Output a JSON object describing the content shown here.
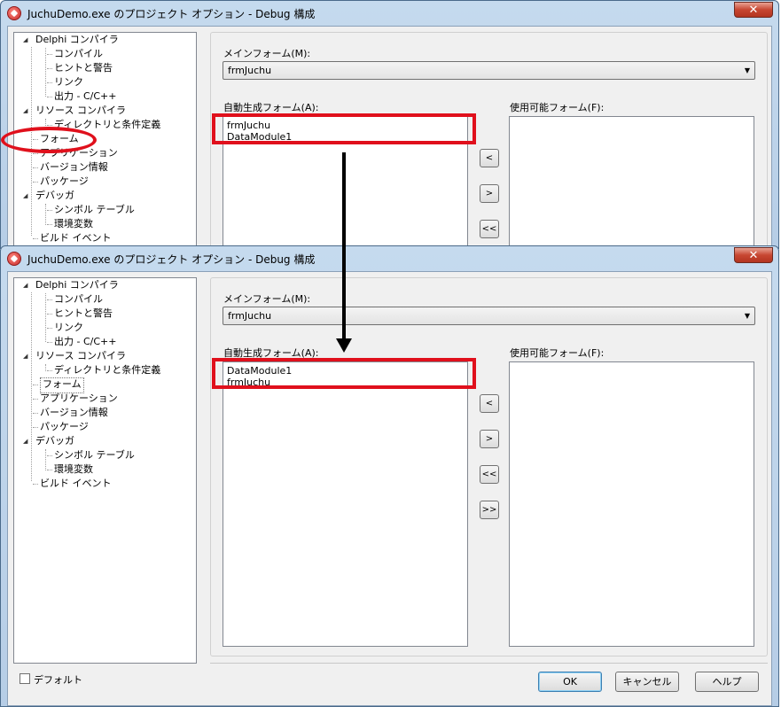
{
  "top_window": {
    "title": "JuchuDemo.exe のプロジェクト オプション - Debug 構成",
    "close_label": "✕",
    "tree": [
      {
        "label": "Delphi コンパイラ"
      },
      {
        "label": "コンパイル"
      },
      {
        "label": "ヒントと警告"
      },
      {
        "label": "リンク"
      },
      {
        "label": "出力 - C/C++"
      },
      {
        "label": "リソース コンパイラ"
      },
      {
        "label": "ディレクトリと条件定義"
      },
      {
        "label": "フォーム"
      },
      {
        "label": "アプリケーション"
      },
      {
        "label": "バージョン情報"
      },
      {
        "label": "パッケージ"
      },
      {
        "label": "デバッガ"
      },
      {
        "label": "シンボル テーブル"
      },
      {
        "label": "環境変数"
      },
      {
        "label": "ビルド イベント"
      }
    ],
    "main_form_label": "メインフォーム(M):",
    "main_form_value": "frmJuchu",
    "auto_create_label": "自動生成フォーム(A):",
    "auto_create_items": [
      "frmJuchu",
      "DataModule1"
    ],
    "available_label": "使用可能フォーム(F):",
    "move_buttons": [
      "<",
      ">",
      "<<"
    ]
  },
  "bottom_window": {
    "title": "JuchuDemo.exe のプロジェクト オプション - Debug 構成",
    "close_label": "✕",
    "tree": [
      {
        "label": "Delphi コンパイラ"
      },
      {
        "label": "コンパイル"
      },
      {
        "label": "ヒントと警告"
      },
      {
        "label": "リンク"
      },
      {
        "label": "出力 - C/C++"
      },
      {
        "label": "リソース コンパイラ"
      },
      {
        "label": "ディレクトリと条件定義"
      },
      {
        "label": "フォーム"
      },
      {
        "label": "アプリケーション"
      },
      {
        "label": "バージョン情報"
      },
      {
        "label": "パッケージ"
      },
      {
        "label": "デバッガ"
      },
      {
        "label": "シンボル テーブル"
      },
      {
        "label": "環境変数"
      },
      {
        "label": "ビルド イベント"
      }
    ],
    "main_form_label": "メインフォーム(M):",
    "main_form_value": "frmJuchu",
    "auto_create_label": "自動生成フォーム(A):",
    "auto_create_items": [
      "DataModule1",
      "frmJuchu"
    ],
    "available_label": "使用可能フォーム(F):",
    "move_buttons": [
      "<",
      ">",
      "<<",
      ">>"
    ],
    "default_checkbox_label": "デフォルト",
    "ok_label": "OK",
    "cancel_label": "キャンセル",
    "help_label": "ヘルプ"
  },
  "colors": {
    "highlight": "#e0101c",
    "titlebar": "#b9d1ea",
    "close_button": "#c74631"
  },
  "icons": [
    "app-icon",
    "close-icon",
    "tree-expand-icon",
    "down-arrow-icon",
    "checkbox-icon"
  ]
}
